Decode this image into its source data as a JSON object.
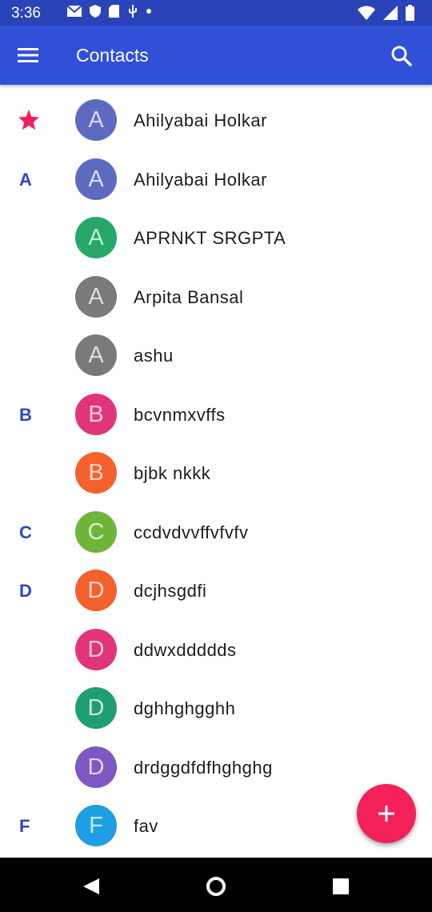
{
  "status_bar": {
    "time": "3:36",
    "left_icons": [
      "gmail-icon",
      "shield-icon",
      "sd-card-icon",
      "usb-icon",
      "dot"
    ],
    "right_icons": [
      "wifi-icon",
      "signal-icon",
      "battery-icon"
    ]
  },
  "app_bar": {
    "title": "Contacts",
    "menu_icon": "hamburger-menu-icon",
    "search_icon": "search-icon"
  },
  "colors": {
    "app_bar": "#3050d8",
    "status_bar": "#2b43b8",
    "section_letter": "#2b47c9",
    "fab": "#f2215a",
    "star": "#f2215a"
  },
  "contacts": [
    {
      "section": "",
      "starred": true,
      "initial": "A",
      "name": "Ahilyabai Holkar",
      "color": "#5c6bc0"
    },
    {
      "section": "A",
      "starred": false,
      "initial": "A",
      "name": "Ahilyabai Holkar",
      "color": "#5c6bc0"
    },
    {
      "section": "",
      "starred": false,
      "initial": "A",
      "name": "APRNKT SRGPTA",
      "color": "#26a86a"
    },
    {
      "section": "",
      "starred": false,
      "initial": "A",
      "name": "Arpita Bansal",
      "color": "#7a7a7a"
    },
    {
      "section": "",
      "starred": false,
      "initial": "A",
      "name": "ashu",
      "color": "#7a7a7a"
    },
    {
      "section": "B",
      "starred": false,
      "initial": "B",
      "name": "bcvnmxvffs",
      "color": "#e0357a"
    },
    {
      "section": "",
      "starred": false,
      "initial": "B",
      "name": "bjbk nkkk",
      "color": "#f4612d"
    },
    {
      "section": "C",
      "starred": false,
      "initial": "C",
      "name": "ccdvdvvffvfvfv",
      "color": "#6fb53a"
    },
    {
      "section": "D",
      "starred": false,
      "initial": "D",
      "name": "dcjhsgdfi",
      "color": "#f4612d"
    },
    {
      "section": "",
      "starred": false,
      "initial": "D",
      "name": "ddwxddddds",
      "color": "#e0357a"
    },
    {
      "section": "",
      "starred": false,
      "initial": "D",
      "name": "dghhghgghh",
      "color": "#1f9e73"
    },
    {
      "section": "",
      "starred": false,
      "initial": "D",
      "name": "drdggdfdfhghghg",
      "color": "#7e57c2"
    },
    {
      "section": "F",
      "starred": false,
      "initial": "F",
      "name": "fav",
      "color": "#1e9fe3"
    }
  ],
  "fab": {
    "icon": "plus-icon"
  },
  "nav_bar": {
    "icons": [
      "back-icon",
      "home-icon",
      "recents-icon"
    ]
  }
}
